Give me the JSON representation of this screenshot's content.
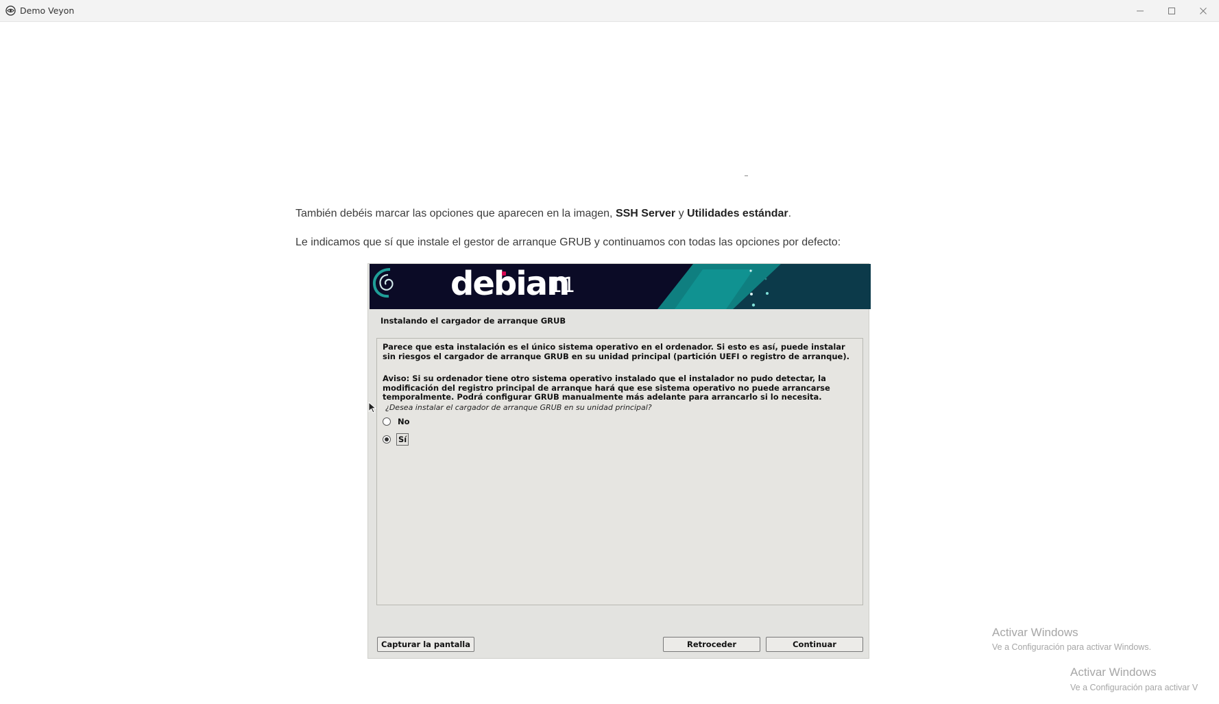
{
  "window": {
    "title": "Demo Veyon",
    "icon": "veyon-eye-icon",
    "controls": [
      "minimize-icon",
      "maximize-icon",
      "close-icon"
    ]
  },
  "article": {
    "p1_pre": "También debéis marcar las opciones que aparecen en la imagen, ",
    "p1_b1": "SSH Server",
    "p1_mid": " y ",
    "p1_b2": "Utilidades estándar",
    "p1_post": ".",
    "p2": "Le indicamos que sí que instale el gestor de arranque GRUB y continuamos con todas las opciones por defecto:"
  },
  "installer": {
    "banner": {
      "brand": "debian",
      "version": "11",
      "colors": {
        "background": "#0b0b26",
        "accent": "#0f9a96",
        "dot": "#d70751"
      }
    },
    "step_title": "Instalando el cargador de arranque GRUB",
    "text1": "Parece que esta instalación es el único sistema operativo en el ordenador. Si esto es así, puede instalar sin riesgos el cargador de arranque GRUB en su unidad principal (partición UEFI o registro de arranque).",
    "text2": "Aviso: Si su ordenador tiene  otro sistema operativo instalado que el instalador no pudo detectar, la modificación del registro principal de arranque hará que ese sistema operativo no puede arrancarse temporalmente. Podrá configurar GRUB manualmente más adelante para arrancarlo si lo necesita.",
    "question": "¿Desea instalar el cargador de arranque GRUB en su unidad principal?",
    "options": [
      {
        "label": "No",
        "selected": false
      },
      {
        "label": "Sí",
        "selected": true
      }
    ],
    "buttons": {
      "screenshot": "Capturar la pantalla",
      "back": "Retroceder",
      "continue": "Continuar"
    }
  },
  "watermarks": [
    {
      "title": "Activar Windows",
      "sub": "Ve a Configuración para activar Windows."
    },
    {
      "title": "Activar Windows",
      "sub": "Ve a Configuración para activar V"
    }
  ]
}
